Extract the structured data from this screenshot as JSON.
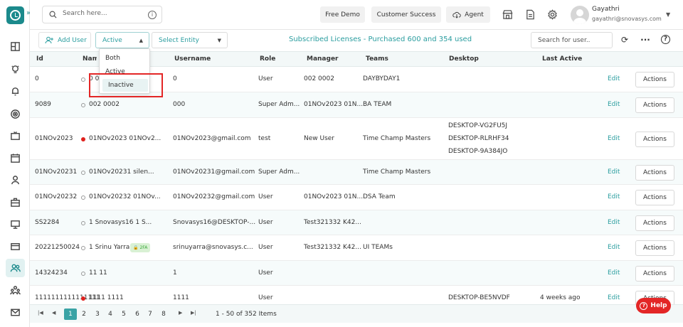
{
  "header": {
    "search_placeholder": "Search here...",
    "free_demo": "Free Demo",
    "customer_success": "Customer Success",
    "agent": "Agent",
    "user_name": "Gayathri",
    "user_email": "gayathri@snovasys.com"
  },
  "toolbar": {
    "add_user": "Add User",
    "status_select": "Active",
    "entity_select": "Select Entity",
    "licenses": "Subscribed Licenses - Purchased 600 and 354 used",
    "user_search_placeholder": "Search for user.."
  },
  "dropdown": {
    "options": [
      "Both",
      "Active",
      "Inactive"
    ],
    "selected": "Inactive"
  },
  "table": {
    "columns": [
      "Id",
      "Name",
      "Username",
      "Role",
      "Manager",
      "Teams",
      "Desktop",
      "Last Active"
    ],
    "edit_label": "Edit",
    "actions_label": "Actions",
    "rows": [
      {
        "id": "0",
        "name": "0 0",
        "username": "0",
        "role": "User",
        "manager": "002 0002",
        "teams": "DAYBYDAY1",
        "desktop": [],
        "last_active": "",
        "status": "gray"
      },
      {
        "id": "9089",
        "name": "002 0002",
        "username": "000",
        "role": "Super Adm...",
        "manager": "01NOv2023 01N...",
        "teams": "BA TEAM",
        "desktop": [],
        "last_active": "",
        "status": "gray"
      },
      {
        "id": "01NOv2023",
        "name": "01NOv2023 01NOv2...",
        "username": "01NOv2023@gmail.com",
        "role": "test",
        "manager": "New User",
        "teams": "Time Champ Masters",
        "desktop": [
          "DESKTOP-VG2FU5J",
          "DESKTOP-RLRHF34",
          "DESKTOP-9A384JO"
        ],
        "last_active": "",
        "status": "red"
      },
      {
        "id": "01NOv20231",
        "name": "01NOv20231 silen...",
        "username": "01NOv20231@gmail.com",
        "role": "Super Adm...",
        "manager": "",
        "teams": "Time Champ Masters",
        "desktop": [],
        "last_active": "",
        "status": "gray"
      },
      {
        "id": "01NOv20232",
        "name": "01NOv20232 01NOv...",
        "username": "01NOv20232@gmail.com",
        "role": "User",
        "manager": "01NOv2023 01N...",
        "teams": "DSA Team",
        "desktop": [],
        "last_active": "",
        "status": "gray"
      },
      {
        "id": "SS2284",
        "name": "1 Snovasys16 1 S...",
        "username": "Snovasys16@DESKTOP-...",
        "role": "User",
        "manager": "Test321332 K42...",
        "teams": "",
        "desktop": [],
        "last_active": "",
        "status": "gray"
      },
      {
        "id": "20221250024",
        "name": "1 Srinu Yarra",
        "badge": "2FA",
        "username": "srinuyarra@snovasys.c...",
        "role": "User",
        "manager": "Test321332 K42...",
        "teams": "UI TEAMs",
        "desktop": [],
        "last_active": "",
        "status": "gray"
      },
      {
        "id": "14324234",
        "name": "11 11",
        "username": "1",
        "role": "User",
        "manager": "",
        "teams": "",
        "desktop": [],
        "last_active": "",
        "status": "gray"
      },
      {
        "id": "1111111111111111",
        "name": "1111 1111",
        "username": "1111",
        "role": "User",
        "manager": "",
        "teams": "",
        "desktop": [
          "DESKTOP-BE5NVDF"
        ],
        "last_active": "4 weeks ago",
        "status": "red"
      }
    ]
  },
  "pagination": {
    "pages": [
      "1",
      "2",
      "3",
      "4",
      "5",
      "6",
      "7",
      "8"
    ],
    "current": "1",
    "info": "1 - 50 of 352 Items"
  },
  "help": {
    "label": "Help"
  },
  "colors": {
    "accent": "#1b8a8c",
    "link": "#2a9d9f",
    "danger": "#e32626"
  }
}
